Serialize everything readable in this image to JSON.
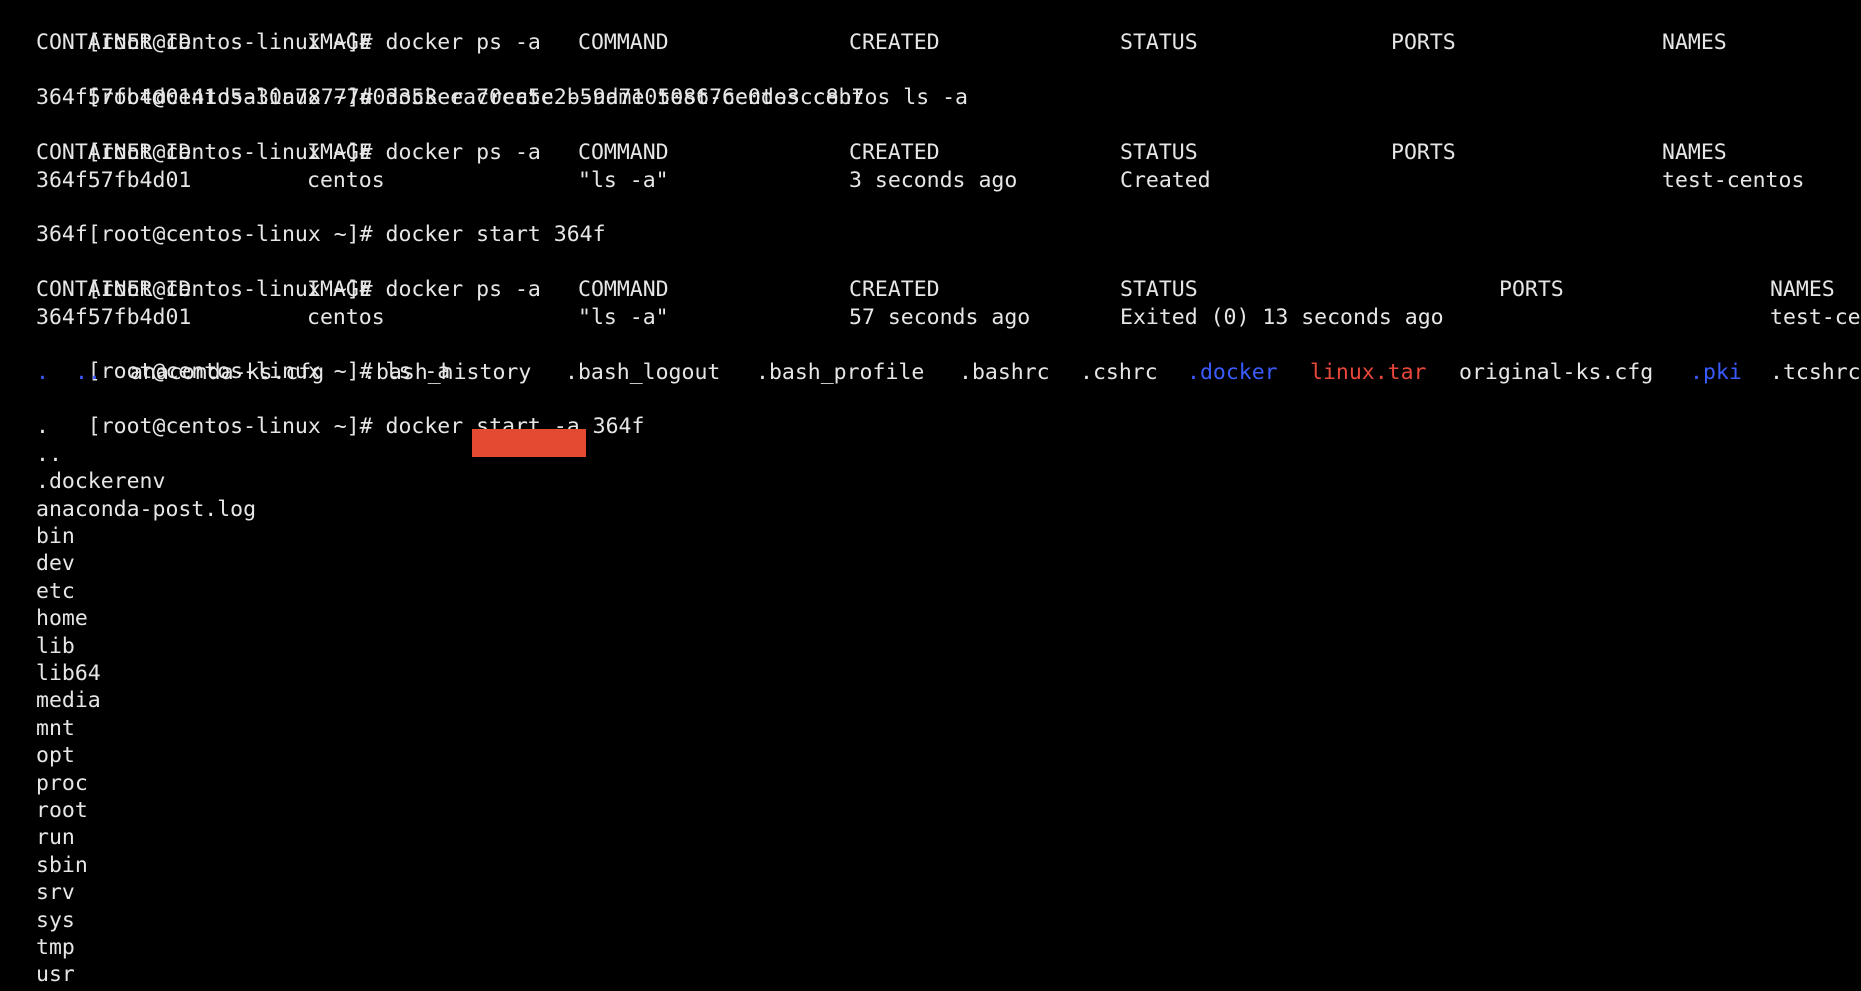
{
  "terminal": {
    "prompt": "[root@centos-linux ~]#",
    "colors": {
      "background": "#000000",
      "text": "#e6e6e6",
      "directory": "#3a5bff",
      "archive": "#e8473a",
      "redaction": "#e44a31"
    },
    "commands": [
      "docker ps -a",
      "docker create --name test-centos centos ls -a",
      "docker ps -a",
      "docker start 364f",
      "docker ps -a",
      "ls -a",
      "docker start -a 364f"
    ],
    "ps1": {
      "headers": [
        "CONTAINER ID",
        "IMAGE",
        "COMMAND",
        "CREATED",
        "STATUS",
        "PORTS",
        "NAMES"
      ]
    },
    "create_output": "364f57fb4d0141d5a30a78777d03353eea70cc5c2b59d710508676e0de3cc8b7",
    "ps2": {
      "headers": [
        "CONTAINER ID",
        "IMAGE",
        "COMMAND",
        "CREATED",
        "STATUS",
        "PORTS",
        "NAMES"
      ],
      "row": [
        "364f57fb4d01",
        "centos",
        "\"ls -a\"",
        "3 seconds ago",
        "Created",
        "",
        "test-centos"
      ]
    },
    "start_output": "364f",
    "ps3": {
      "headers": [
        "CONTAINER ID",
        "IMAGE",
        "COMMAND",
        "CREATED",
        "STATUS",
        "PORTS",
        "NAMES"
      ],
      "row": [
        "364f57fb4d01",
        "centos",
        "\"ls -a\"",
        "57 seconds ago",
        "Exited (0) 13 seconds ago",
        "",
        "test-ce"
      ]
    },
    "ls_entries": [
      {
        "name": ".",
        "color": "blue"
      },
      {
        "name": "..",
        "color": "blue"
      },
      {
        "name": "anaconda-ks.cfg",
        "color": "default"
      },
      {
        "name": ".bash_history",
        "color": "default"
      },
      {
        "name": ".bash_logout",
        "color": "default"
      },
      {
        "name": ".bash_profile",
        "color": "default"
      },
      {
        "name": ".bashrc",
        "color": "default"
      },
      {
        "name": ".cshrc",
        "color": "default"
      },
      {
        "name": ".docker",
        "color": "blue"
      },
      {
        "name": "linux.tar",
        "color": "red"
      },
      {
        "name": "original-ks.cfg",
        "color": "default"
      },
      {
        "name": ".pki",
        "color": "blue"
      },
      {
        "name": ".tcshrc",
        "color": "default"
      }
    ],
    "container_ls": [
      ".",
      "..",
      ".dockerenv",
      "anaconda-post.log",
      "bin",
      "dev",
      "etc",
      "home",
      "lib",
      "lib64",
      "media",
      "mnt",
      "opt",
      "proc",
      "root",
      "run",
      "sbin",
      "srv",
      "sys",
      "tmp",
      "usr"
    ]
  }
}
